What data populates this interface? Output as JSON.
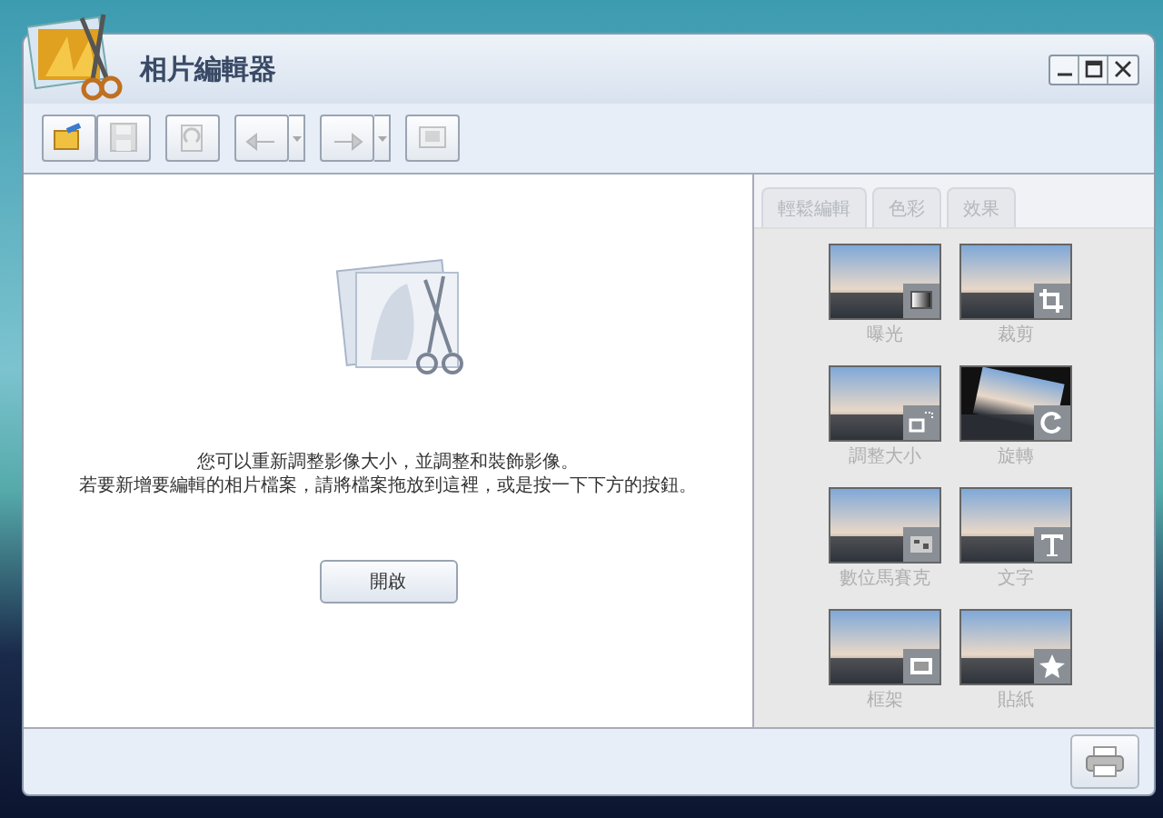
{
  "window": {
    "title": "相片編輯器"
  },
  "toolbar": [
    {
      "kind": "button",
      "disabled": false
    },
    {
      "kind": "button",
      "disabled": true
    },
    {
      "kind": "button",
      "disabled": true
    },
    {
      "kind": "split",
      "disabled": true
    },
    {
      "kind": "split",
      "disabled": true
    },
    {
      "kind": "button",
      "disabled": true
    }
  ],
  "main": {
    "message": [
      "您可以重新調整影像大小，並調整和裝飾影像。",
      "若要新增要編輯的相片檔案，請將檔案拖放到這裡，或是按一下下方的按鈕。"
    ],
    "open_button": "開啟"
  },
  "side_tabs": [
    {
      "label": "輕鬆編輯",
      "disabled": true
    },
    {
      "label": "色彩",
      "disabled": true
    },
    {
      "label": "效果",
      "disabled": true
    }
  ],
  "tools": [
    {
      "label": "曝光",
      "disabled": true
    },
    {
      "label": "裁剪",
      "disabled": true
    },
    {
      "label": "調整大小",
      "disabled": true
    },
    {
      "label": "旋轉",
      "disabled": true
    },
    {
      "label": "數位馬賽克",
      "disabled": true
    },
    {
      "label": "文字",
      "disabled": true
    },
    {
      "label": "框架",
      "disabled": true
    },
    {
      "label": "貼紙",
      "disabled": true
    }
  ],
  "footer": {
    "print_disabled": false
  }
}
